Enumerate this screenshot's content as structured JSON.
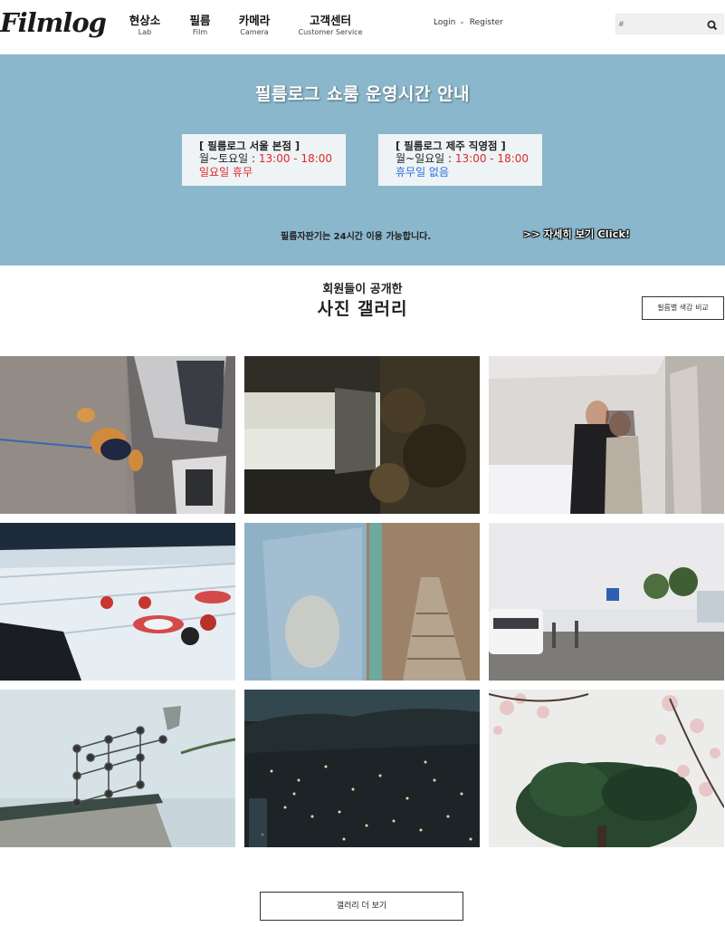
{
  "header": {
    "logo": "Filmlog",
    "nav": [
      {
        "ko": "현상소",
        "en": "Lab"
      },
      {
        "ko": "필름",
        "en": "Film"
      },
      {
        "ko": "카메라",
        "en": "Camera"
      },
      {
        "ko": "고객센터",
        "en": "Customer Service"
      }
    ],
    "login": "Login",
    "register": "Register",
    "search_placeholder": "#"
  },
  "banner": {
    "title": "필름로그 쇼룸 운영시간 안내",
    "stores": [
      {
        "name": "[ 필름로그 서울 본점 ]",
        "days": "월~토요일 : ",
        "time": "13:00 - 18:00",
        "closed": "일요일 휴무",
        "closed_color": "red"
      },
      {
        "name": "[ 필름로그 제주 직영점 ]",
        "days": "월~일요일 : ",
        "time": "13:00 - 18:00",
        "closed": "휴무일 없음",
        "closed_color": "blue"
      }
    ],
    "note": "필름자판기는 24시간 이용 가능합니다.",
    "more": ">> 자세히 보기 Click!"
  },
  "gallery": {
    "subtitle": "회원들이 공개한",
    "title": "사진 갤러리",
    "compare_button": "필름별 색감 비교",
    "more_button": "갤러리 더 보기",
    "photos": [
      "dog-on-street",
      "building-and-trees",
      "couple-selfie",
      "wheelchair-curling",
      "double-exposure-stairs",
      "bus-stop-parking",
      "molecule-sculpture",
      "city-night-view",
      "cherry-blossom-tree"
    ]
  },
  "colors": {
    "banner_bg": "#8ab7cb",
    "accent_red": "#e0282a",
    "accent_blue": "#2f6ed8"
  }
}
